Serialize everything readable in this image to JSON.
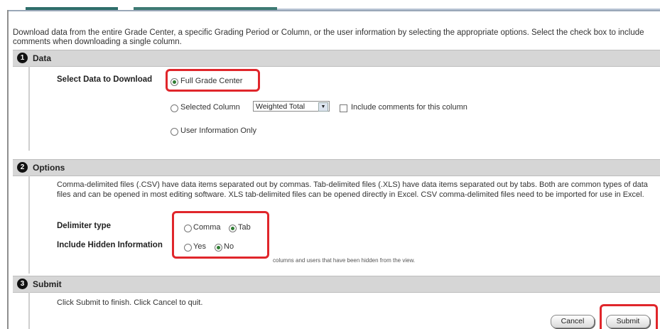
{
  "intro": "Download data from the entire Grade Center, a specific Grading Period or Column, or the user information by selecting the appropriate options. Select the check box to include comments when downloading a single column.",
  "sections": {
    "data": {
      "number": "1",
      "title": "Data",
      "field_label": "Select Data to Download",
      "option_full": "Full Grade Center",
      "option_column": "Selected Column",
      "column_select_value": "Weighted Total",
      "include_comments": "Include comments for this column",
      "option_user": "User Information Only",
      "selected": "Full Grade Center"
    },
    "options": {
      "number": "2",
      "title": "Options",
      "description": "Comma-delimited files (.CSV) have data items separated out by commas. Tab-delimited files (.XLS) have data items separated out by tabs. Both are common types of data files and can be opened in most editing software. XLS tab-delimited files can be opened directly in Excel. CSV comma-delimited files need to be imported for use in Excel.",
      "delimiter_label": "Delimiter type",
      "delimiter_comma": "Comma",
      "delimiter_tab": "Tab",
      "delimiter_selected": "Tab",
      "hidden_label": "Include Hidden Information",
      "hidden_yes": "Yes",
      "hidden_no": "No",
      "hidden_selected": "No",
      "hidden_hint": "columns and users that have been hidden from the view."
    },
    "submit": {
      "number": "3",
      "title": "Submit",
      "instruction": "Click Submit to finish. Click Cancel to quit.",
      "cancel_label": "Cancel",
      "submit_label": "Submit"
    }
  },
  "colors": {
    "highlight": "#e0262b",
    "section_header": "#d6d6d6",
    "radio_on": "#2e7d32"
  }
}
